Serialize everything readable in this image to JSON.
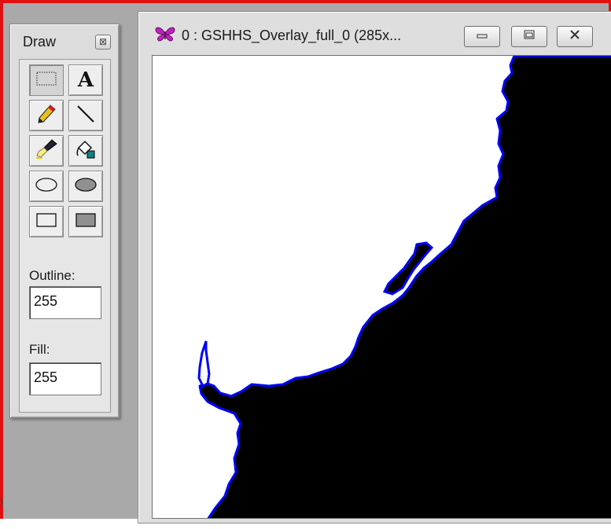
{
  "palette": {
    "title": "Draw",
    "close_glyph": "⊠",
    "tools": [
      {
        "name": "rectangle-select",
        "icon": "selection-rect-icon"
      },
      {
        "name": "text",
        "icon": "text-icon",
        "glyph": "A"
      },
      {
        "name": "pencil",
        "icon": "pencil-icon"
      },
      {
        "name": "line",
        "icon": "line-icon"
      },
      {
        "name": "brush",
        "icon": "brush-icon"
      },
      {
        "name": "fill",
        "icon": "paint-bucket-icon"
      },
      {
        "name": "ellipse-outline",
        "icon": "ellipse-outline-icon"
      },
      {
        "name": "ellipse-filled",
        "icon": "ellipse-filled-icon"
      },
      {
        "name": "rect-outline",
        "icon": "rect-outline-icon"
      },
      {
        "name": "rect-filled",
        "icon": "rect-filled-icon"
      }
    ],
    "outline_label": "Outline:",
    "outline_value": "255",
    "fill_label": "Fill:",
    "fill_value": "255"
  },
  "image_window": {
    "title": "0 : GSHHS_Overlay_full_0 (285x...",
    "app_icon": "butterfly-icon",
    "buttons": [
      "minimize",
      "maximize",
      "close"
    ]
  },
  "edge_text": ")",
  "colors": {
    "frame_border": "#e01010",
    "land": "#000000",
    "water": "#ffffff",
    "coastline": "#0000ff"
  }
}
